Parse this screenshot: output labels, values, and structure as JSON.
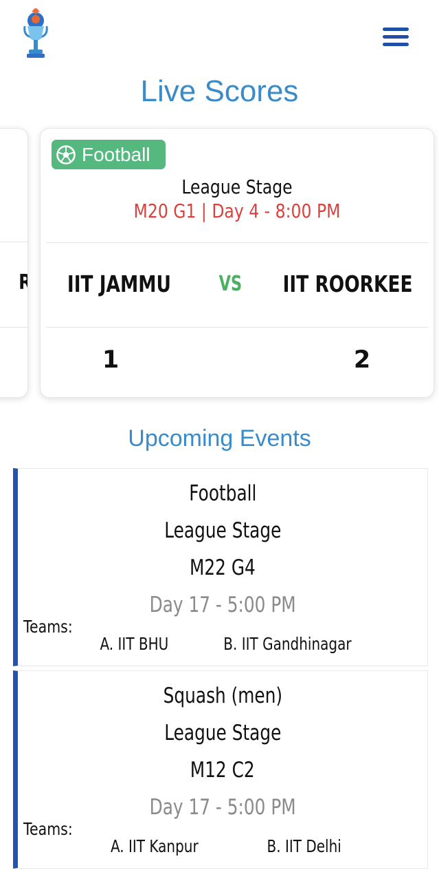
{
  "header": {
    "logo_icon": "trophy-logo-icon",
    "menu_icon": "hamburger-menu-icon"
  },
  "live": {
    "title": "Live Scores",
    "previous_card": {
      "team_fragment": "R"
    },
    "card": {
      "sport": "Football",
      "sport_icon": "football-icon",
      "stage": "League Stage",
      "when": "M20 G1 | Day 4 - 8:00 PM",
      "team_a": "IIT JAMMU",
      "vs": "VS",
      "team_b": "IIT ROORKEE",
      "score_a": "1",
      "score_b": "2"
    }
  },
  "upcoming": {
    "title": "Upcoming Events",
    "events": [
      {
        "sport": "Football",
        "stage": "League Stage",
        "match": "M22 G4",
        "time": "Day 17 - 5:00 PM",
        "teams_label": "Teams:",
        "team_a": "A. IIT BHU",
        "team_b": "B. IIT Gandhinagar"
      },
      {
        "sport": "Squash (men)",
        "stage": "League Stage",
        "match": "M12 C2",
        "time": "Day 17 - 5:00 PM",
        "teams_label": "Teams:",
        "team_a": "A. IIT Kanpur",
        "team_b": "B. IIT Delhi"
      }
    ]
  },
  "colors": {
    "accent_blue": "#3a8bc9",
    "menu_blue": "#1f4fa6",
    "event_bar": "#2352b0",
    "badge_green": "#55b87e",
    "vs_green": "#4caf64",
    "time_red": "#d9413c"
  }
}
